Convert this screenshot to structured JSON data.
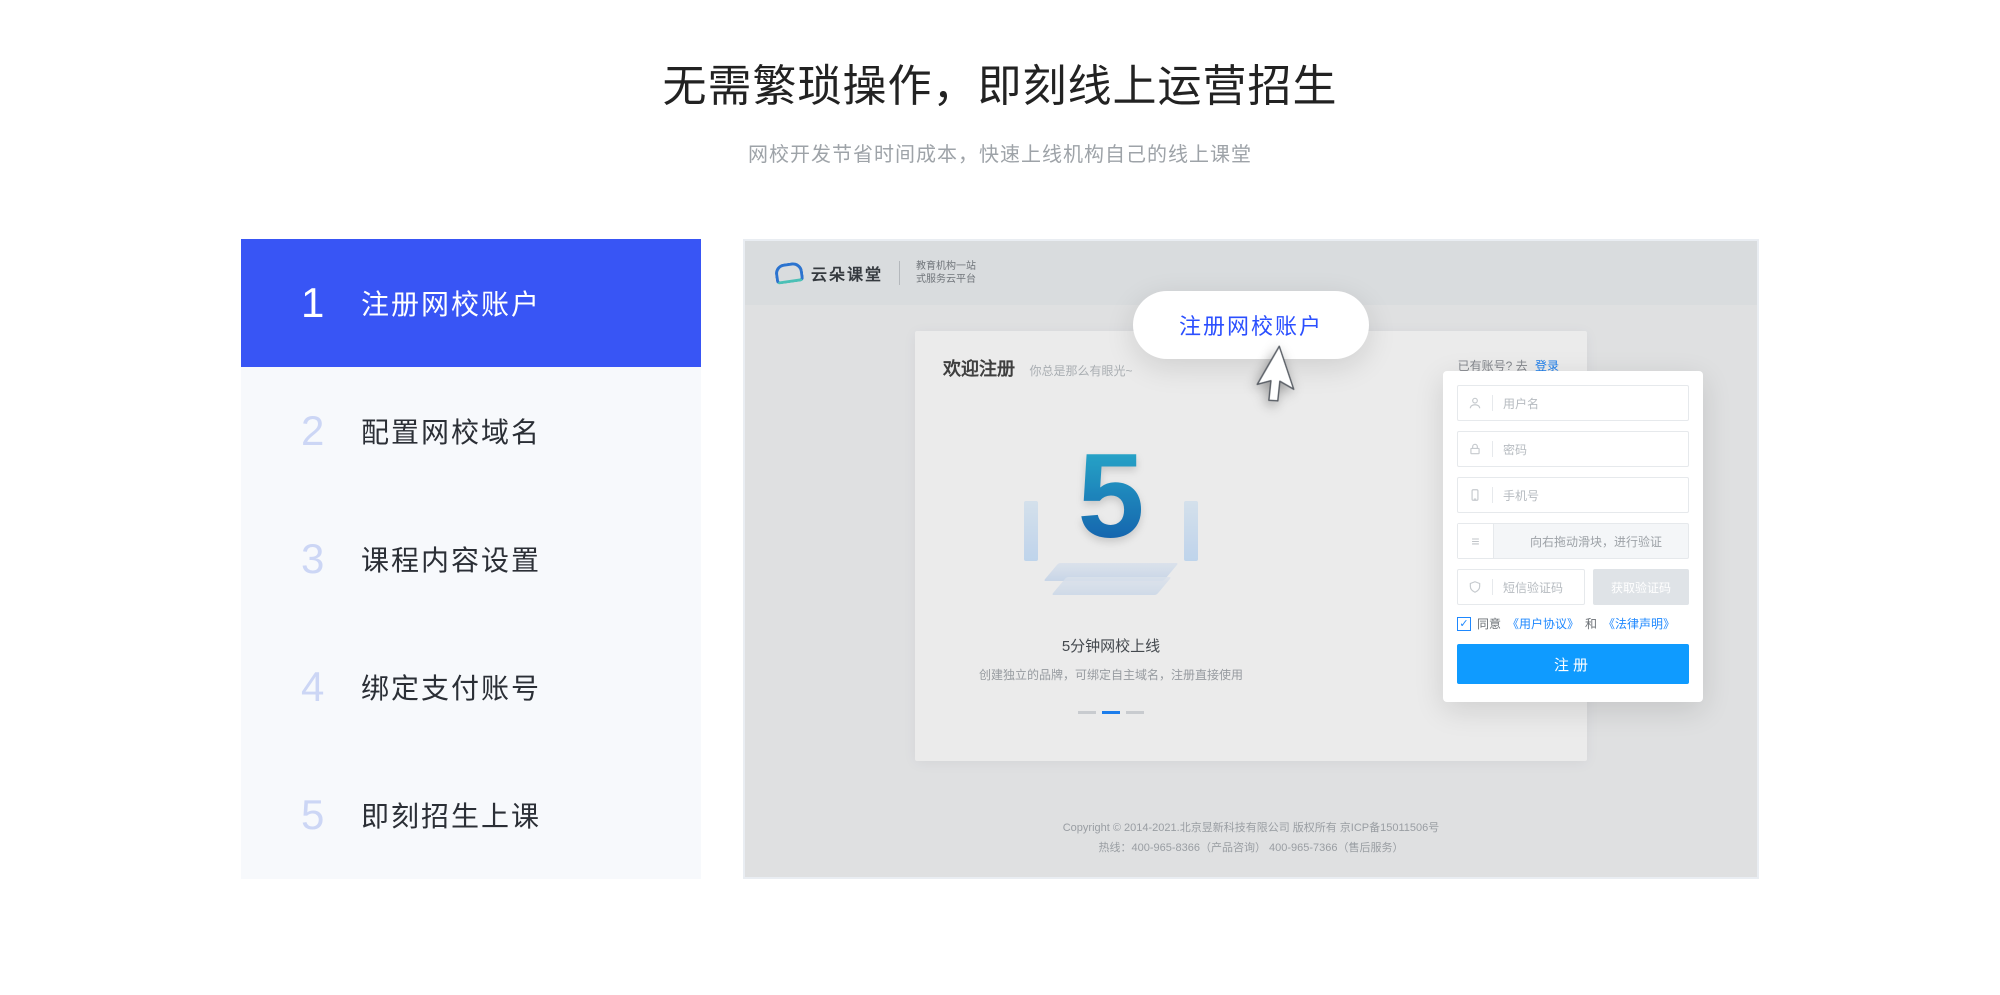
{
  "title": "无需繁琐操作，即刻线上运营招生",
  "subtitle": "网校开发节省时间成本，快速上线机构自己的线上课堂",
  "steps": [
    {
      "num": "1",
      "label": "注册网校账户",
      "active": true
    },
    {
      "num": "2",
      "label": "配置网校域名",
      "active": false
    },
    {
      "num": "3",
      "label": "课程内容设置",
      "active": false
    },
    {
      "num": "4",
      "label": "绑定支付账号",
      "active": false
    },
    {
      "num": "5",
      "label": "即刻招生上课",
      "active": false
    }
  ],
  "bubble": "注册网校账户",
  "inner": {
    "logo_text": "云朵课堂",
    "logo_sub_line1": "教育机构一站",
    "logo_sub_line2": "式服务云平台",
    "welcome": "欢迎注册",
    "slogan": "你总是那么有眼光~",
    "login_hint_prefix": "已有账号? 去",
    "login_hint_link": "登录",
    "ill_title": "5分钟网校上线",
    "ill_sub": "创建独立的品牌，可绑定自主域名，注册直接使用",
    "footer_line1": "Copyright © 2014-2021.北京昱新科技有限公司 版权所有   京ICP备15011506号",
    "footer_line2": "热线：400-965-8366（产品咨询）  400-965-7366（售后服务）"
  },
  "form": {
    "username_placeholder": "用户名",
    "password_placeholder": "密码",
    "phone_placeholder": "手机号",
    "slider_text": "向右拖动滑块，进行验证",
    "sms_placeholder": "短信验证码",
    "get_code_label": "获取验证码",
    "agree_prefix": "同意",
    "agree_link1": "《用户协议》",
    "agree_and": "和",
    "agree_link2": "《法律声明》",
    "register_label": "注册"
  }
}
